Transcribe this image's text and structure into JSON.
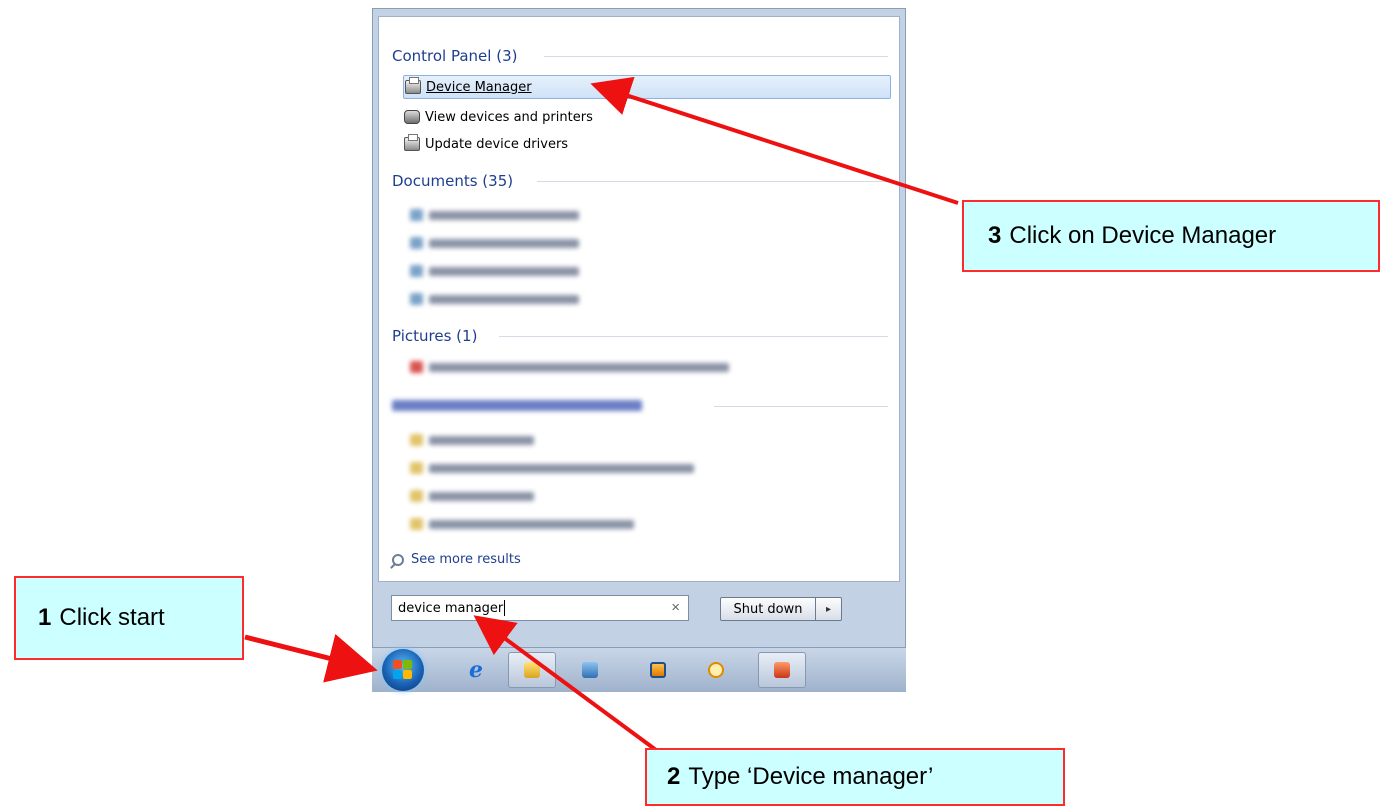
{
  "start_menu": {
    "groups": [
      {
        "header": "Control Panel (3)",
        "items": [
          {
            "label": "Device Manager",
            "icon": "device-manager-icon",
            "selected": true
          },
          {
            "label": "View devices and printers",
            "icon": "devices-printers-icon"
          },
          {
            "label": "Update device drivers",
            "icon": "device-manager-icon"
          }
        ]
      },
      {
        "header": "Documents (35)"
      },
      {
        "header": "Pictures (1)"
      }
    ],
    "see_more": "See more results",
    "search": {
      "value": "device manager"
    },
    "shutdown_label": "Shut down",
    "shutdown_arrow": "▸"
  },
  "taskbar": {
    "buttons": [
      "start-orb",
      "internet-explorer-icon",
      "windows-explorer-icon",
      "program-icon",
      "media-player-icon",
      "clock-app-icon",
      "powerpoint-icon"
    ]
  },
  "callouts": {
    "step1": {
      "num": "1",
      "text": "Click start"
    },
    "step2": {
      "num": "2",
      "text": "Type  ‘Device manager’"
    },
    "step3": {
      "num": "3",
      "text": "Click on Device Manager"
    }
  },
  "colors": {
    "callout_bg": "#ccffff",
    "callout_border": "#ff2a2a",
    "arrow": "#ee1111",
    "group_header": "#1e3f8f"
  }
}
